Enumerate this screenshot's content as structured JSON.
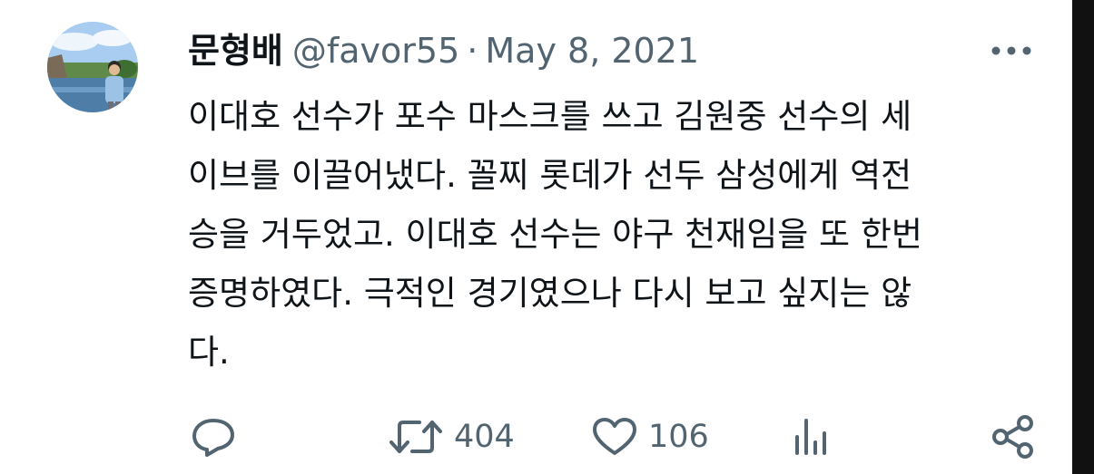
{
  "tweet": {
    "display_name": "문형배",
    "handle": "@favor55",
    "separator": "·",
    "date": "May 8, 2021",
    "body_lines": [
      "이대호 선수가 포수 마스크를 쓰고 김원중 선수의 세",
      "이브를 이끌어냈다. 꼴찌 롯데가 선두 삼성에게 역전",
      "승을 거두었고. 이대호 선수는 야구 천재임을 또 한번",
      "증명하였다. 극적인 경기였으나 다시 보고 싶지는 않",
      "다."
    ]
  },
  "actions": {
    "reply": {
      "icon": "reply-icon",
      "count": ""
    },
    "retweet": {
      "icon": "retweet-icon",
      "count": "404"
    },
    "like": {
      "icon": "heart-icon",
      "count": "106"
    },
    "views": {
      "icon": "analytics-icon",
      "count": ""
    },
    "share": {
      "icon": "share-icon",
      "count": ""
    }
  },
  "colors": {
    "text_primary": "#0f1419",
    "text_secondary": "#536471",
    "background": "#ffffff",
    "scrollbar": "#111111"
  }
}
